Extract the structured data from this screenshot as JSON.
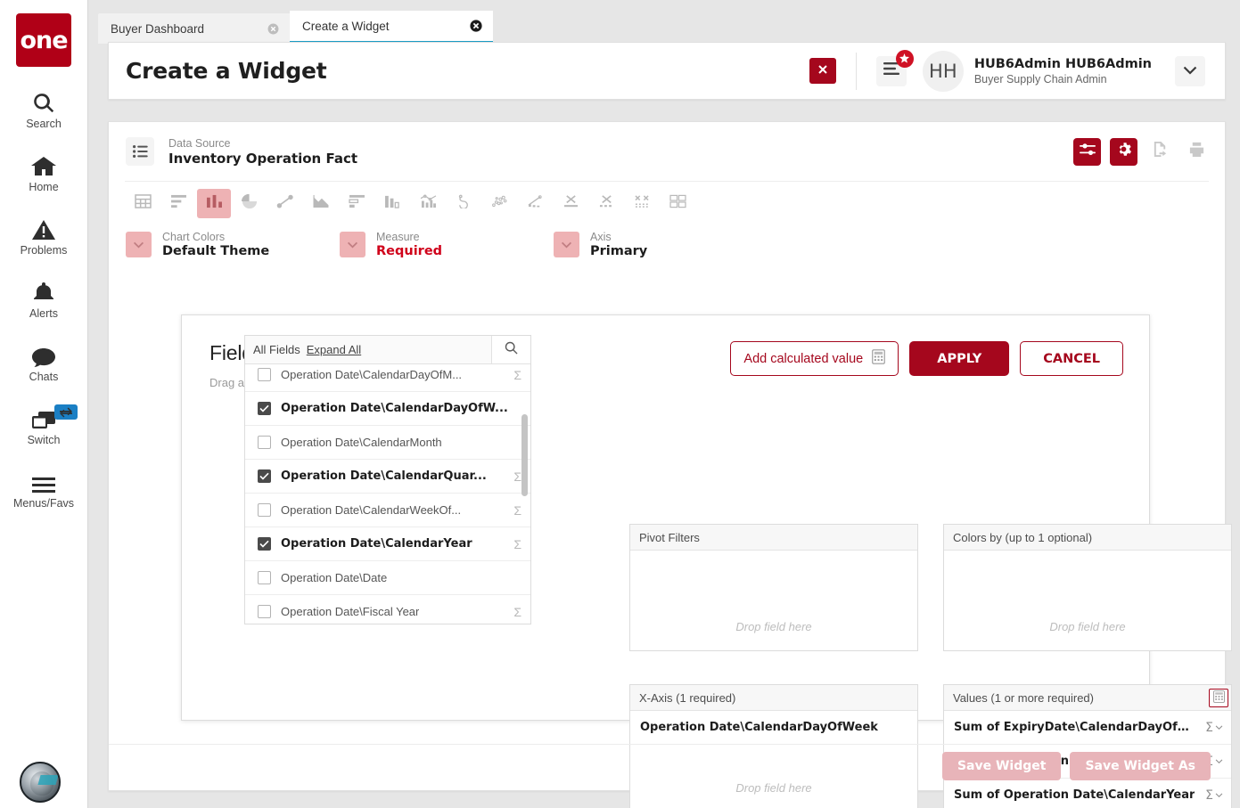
{
  "brand": {
    "logo_text": "one",
    "accent": "#a5071d",
    "highlight": "#eeb2b4"
  },
  "sidebar": {
    "items": [
      {
        "label": "Search",
        "icon": "search-icon"
      },
      {
        "label": "Home",
        "icon": "home-icon"
      },
      {
        "label": "Problems",
        "icon": "warning-triangle-icon"
      },
      {
        "label": "Alerts",
        "icon": "bell-icon"
      },
      {
        "label": "Chats",
        "icon": "chat-bubble-icon"
      },
      {
        "label": "Switch",
        "icon": "windows-stack-icon",
        "badge_icon": "swap-arrows-icon"
      },
      {
        "label": "Menus/Favs",
        "icon": "hamburger-icon"
      }
    ]
  },
  "tabs": [
    {
      "label": "Buyer Dashboard",
      "active": false
    },
    {
      "label": "Create a Widget",
      "active": true
    }
  ],
  "header": {
    "title": "Create a Widget",
    "close_icon": "close-x-icon",
    "menu_icon": "list-menu-icon",
    "badge_icon": "star-icon",
    "avatar_initials": "HH",
    "user_name": "HUB6Admin HUB6Admin",
    "user_role": "Buyer Supply Chain Admin",
    "chevron_icon": "chevron-down-icon"
  },
  "datasource": {
    "icon": "list-view-icon",
    "label": "Data Source",
    "value": "Inventory Operation Fact",
    "actions": [
      {
        "name": "filter-settings-button",
        "icon": "sliders-icon",
        "style": "red"
      },
      {
        "name": "gear-settings-button",
        "icon": "gear-icon",
        "style": "red"
      },
      {
        "name": "export-button",
        "icon": "export-file-icon",
        "style": "ghost"
      },
      {
        "name": "print-button",
        "icon": "printer-icon",
        "style": "ghost"
      }
    ]
  },
  "chart_types": [
    {
      "name": "table-chart",
      "icon": "table-grid-icon",
      "selected": false
    },
    {
      "name": "bar-chart",
      "icon": "horizontal-bars-icon",
      "selected": false
    },
    {
      "name": "column-chart",
      "icon": "vertical-bars-icon",
      "selected": true
    },
    {
      "name": "pie-chart",
      "icon": "pie-icon",
      "selected": false
    },
    {
      "name": "line-chart",
      "icon": "line-trend-icon",
      "selected": false
    },
    {
      "name": "area-chart",
      "icon": "area-mountain-icon",
      "selected": false
    },
    {
      "name": "stacked-bar-chart",
      "icon": "stacked-horizontal-bars-icon",
      "selected": false
    },
    {
      "name": "grouped-column-chart",
      "icon": "grouped-columns-icon",
      "selected": false
    },
    {
      "name": "combo-chart",
      "icon": "columns-with-line-icon",
      "selected": false
    },
    {
      "name": "funnel-chart",
      "icon": "spiral-loop-icon",
      "selected": false
    },
    {
      "name": "bubble-chart",
      "icon": "bubble-dots-icon",
      "selected": false
    },
    {
      "name": "scatter-line-chart",
      "icon": "scatter-line-icon",
      "selected": false
    },
    {
      "name": "box-plot-chart",
      "icon": "x-over-line-icon",
      "selected": false
    },
    {
      "name": "range-chart",
      "icon": "x-over-dashed-line-icon",
      "selected": false
    },
    {
      "name": "multi-x-chart",
      "icon": "double-x-dotted-icon",
      "selected": false
    },
    {
      "name": "tile-chart",
      "icon": "four-tiles-icon",
      "selected": false
    }
  ],
  "options": [
    {
      "name": "chart-colors",
      "label": "Chart Colors",
      "value": "Default Theme",
      "required": false
    },
    {
      "name": "measure",
      "label": "Measure",
      "value": "Required",
      "required": true
    },
    {
      "name": "axis",
      "label": "Axis",
      "value": "Primary",
      "required": false
    }
  ],
  "fields_panel": {
    "title": "Fields (Column Chart)",
    "subtitle": "Drag and drop fields to arrange",
    "add_calculated_label": "Add calculated value",
    "add_calculated_icon": "calculator-icon",
    "apply_label": "APPLY",
    "cancel_label": "CANCEL"
  },
  "field_list": {
    "header_label": "All Fields",
    "expand_all_label": "Expand All",
    "search_icon": "search-icon",
    "rows": [
      {
        "label": "Operation Date\\CalendarDayOfM...",
        "checked": false,
        "sigma": true
      },
      {
        "label": "Operation Date\\CalendarDayOfW...",
        "checked": true,
        "sigma": false
      },
      {
        "label": "Operation Date\\CalendarMonth",
        "checked": false,
        "sigma": false
      },
      {
        "label": "Operation Date\\CalendarQuar...",
        "checked": true,
        "sigma": true
      },
      {
        "label": "Operation Date\\CalendarWeekOf...",
        "checked": false,
        "sigma": true
      },
      {
        "label": "Operation Date\\CalendarYear",
        "checked": true,
        "sigma": true
      },
      {
        "label": "Operation Date\\Date",
        "checked": false,
        "sigma": false
      },
      {
        "label": "Operation Date\\Fiscal Year",
        "checked": false,
        "sigma": true
      }
    ]
  },
  "zones": {
    "pivot_filters": {
      "title": "Pivot Filters",
      "placeholder": "Drop field here",
      "items": []
    },
    "colors_by": {
      "title": "Colors by (up to 1 optional)",
      "placeholder": "Drop field here",
      "items": []
    },
    "x_axis": {
      "title": "X-Axis (1 required)",
      "placeholder": "Drop field here",
      "items": [
        {
          "label": "Operation Date\\CalendarDayOfWeek",
          "agg": ""
        }
      ]
    },
    "values": {
      "title": "Values (1 or more required)",
      "calc_icon": "calculator-icon",
      "placeholder": "",
      "items": [
        {
          "label": "Sum of ExpiryDate\\CalendarDayOfM...",
          "agg": "Σ"
        },
        {
          "label": "Sum of Operation Date\\CalendarQua...",
          "agg": "Σ"
        },
        {
          "label": "Sum of Operation Date\\CalendarYear",
          "agg": "Σ"
        }
      ]
    }
  },
  "footer": {
    "save_widget_label": "Save Widget",
    "save_widget_as_label": "Save Widget As"
  }
}
